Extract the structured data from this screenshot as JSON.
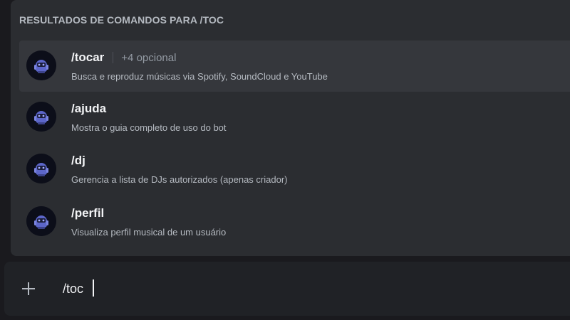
{
  "popup": {
    "header": "RESULTADOS DE COMANDOS PARA /TOC",
    "items": [
      {
        "name": "/tocar",
        "options": "+4 opcional",
        "description": "Busca e reproduz músicas via Spotify, SoundCloud e YouTube",
        "icon": "bot-avatar-icon",
        "selected": true
      },
      {
        "name": "/ajuda",
        "description": "Mostra o guia completo de uso do bot",
        "icon": "bot-avatar-icon"
      },
      {
        "name": "/dj",
        "description": "Gerencia a lista de DJs autorizados (apenas criador)",
        "icon": "bot-avatar-icon"
      },
      {
        "name": "/perfil",
        "description": "Visualiza perfil musical de um usuário",
        "icon": "bot-avatar-icon"
      }
    ]
  },
  "composer": {
    "value": "/toc",
    "plus_icon": "plus-icon"
  },
  "colors": {
    "popup_bg": "#2b2d31",
    "selected_bg": "#35373c",
    "composer_bg": "#202226",
    "text_primary": "#f2f3f5",
    "text_muted": "#949ba4"
  }
}
